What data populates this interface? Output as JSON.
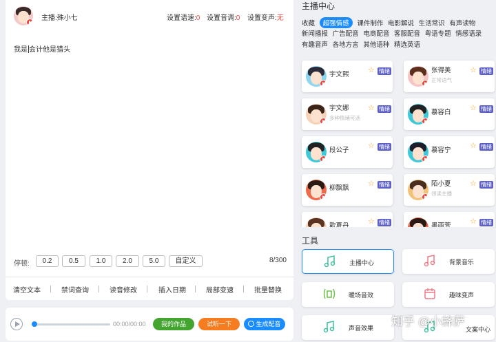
{
  "editor": {
    "host_label": "主播:殊小七",
    "speed_label": "设置语速:",
    "speed_value": "0",
    "pitch_label": "设置音调:",
    "pitch_value": "0",
    "voice_label": "设置变声:",
    "voice_value": "无",
    "text_before": "我是",
    "text_after": "会计他是猎头",
    "pause_label": "停顿:",
    "pause_options": [
      "0.2",
      "0.5",
      "1.0",
      "2.0",
      "5.0",
      "自定义"
    ],
    "counter": "8/300",
    "tools": [
      "清空文本",
      "禁词查询",
      "读音修改",
      "插入日期",
      "局部变速",
      "批量替换"
    ]
  },
  "player": {
    "time": "00:00/00:00",
    "my_works": "我的作品",
    "try_listen": "试听一下",
    "generate": "生成配音"
  },
  "right": {
    "title": "主播中心",
    "categories_row1": [
      "收藏",
      "超强情感",
      "课件制作",
      "电影解说",
      "生活常识",
      "有声读物"
    ],
    "categories_row2": [
      "新闻播报",
      "广告配音",
      "电商配音",
      "客服配音",
      "粤语专题",
      "情感语录"
    ],
    "categories_row3": [
      "有趣音声",
      "各地方言",
      "其他语种",
      "精选英语"
    ],
    "anchors": [
      {
        "name": "宇文熙",
        "desc": "",
        "badge": "情绪"
      },
      {
        "name": "张得美",
        "desc": "正常语气",
        "badge": "情绪"
      },
      {
        "name": "宇文娜",
        "desc": "多种情绪可选",
        "badge": "情绪"
      },
      {
        "name": "慕容白",
        "desc": "",
        "badge": "情绪"
      },
      {
        "name": "段公子",
        "desc": "",
        "badge": "情绪"
      },
      {
        "name": "慕容宁",
        "desc": "",
        "badge": "情绪"
      },
      {
        "name": "柳飘飘",
        "desc": "",
        "badge": "情绪"
      },
      {
        "name": "陌小夏",
        "desc": "领读主播",
        "badge": "情绪"
      },
      {
        "name": "歡夏丹",
        "desc": "",
        "badge": "情绪"
      },
      {
        "name": "墨雨萱",
        "desc": "",
        "badge": "情绪"
      }
    ],
    "tools_title": "工具",
    "tools": [
      "主播中心",
      "背景音乐",
      "暖场音效",
      "趣味变声",
      "声音效果",
      "文案中心"
    ]
  },
  "watermark": "知乎 @小蜂萨",
  "colors": {
    "accent": "#1a8cff",
    "red": "#e8453c",
    "green": "#43a42f",
    "orange": "#f57c1f",
    "badge": "#5b5fc7"
  }
}
